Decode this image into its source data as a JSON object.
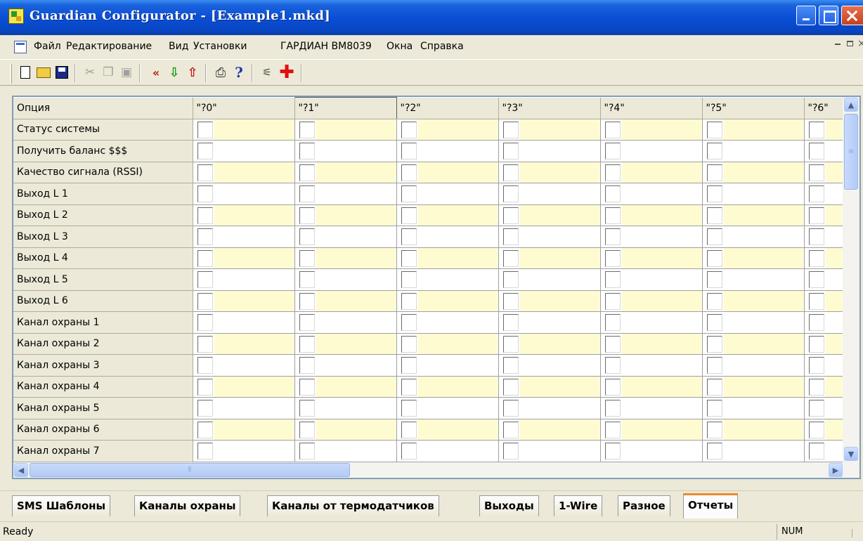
{
  "window": {
    "title": "Guardian Configurator - [Example1.mkd]"
  },
  "menu": {
    "items": [
      "Файл",
      "Редактирование",
      "Вид",
      "Установки",
      "ГАРДИАН BM8039",
      "Окна",
      "Справка"
    ]
  },
  "toolbar": {
    "icons": [
      "new-document-icon",
      "open-folder-icon",
      "save-disk-icon",
      "cut-icon",
      "copy-icon",
      "paste-icon",
      "read-from-device-icon",
      "download-icon",
      "upload-icon",
      "print-icon",
      "help-icon",
      "wand-icon",
      "red-cross-icon"
    ]
  },
  "grid": {
    "option_header": "Опция",
    "columns": [
      "\"?0\"",
      "\"?1\"",
      "\"?2\"",
      "\"?3\"",
      "\"?4\"",
      "\"?5\"",
      "\"?6\""
    ],
    "selected_column": "\"?1\"",
    "rows": [
      "Статус системы",
      "Получить баланс $$$",
      "Качество сигнала (RSSI)",
      "Выход L 1",
      "Выход L 2",
      "Выход L 3",
      "Выход L 4",
      "Выход L 5",
      "Выход L 6",
      "Канал охраны 1",
      "Канал охраны 2",
      "Канал охраны 3",
      "Канал охраны 4",
      "Канал охраны 5",
      "Канал охраны 6",
      "Канал охраны 7"
    ],
    "checked": []
  },
  "tabs": {
    "items": [
      "SMS Шаблоны",
      "Каналы охраны",
      "Каналы от термодатчиков",
      "Выходы",
      "1-Wire",
      "Разное",
      "Отчеты"
    ],
    "active": "Отчеты"
  },
  "status": {
    "text": "Ready",
    "num": "NUM"
  },
  "colors": {
    "title_bar": "#0a4fd6",
    "row_highlight": "#fffbd1",
    "active_tab_accent": "#e68b2c"
  }
}
